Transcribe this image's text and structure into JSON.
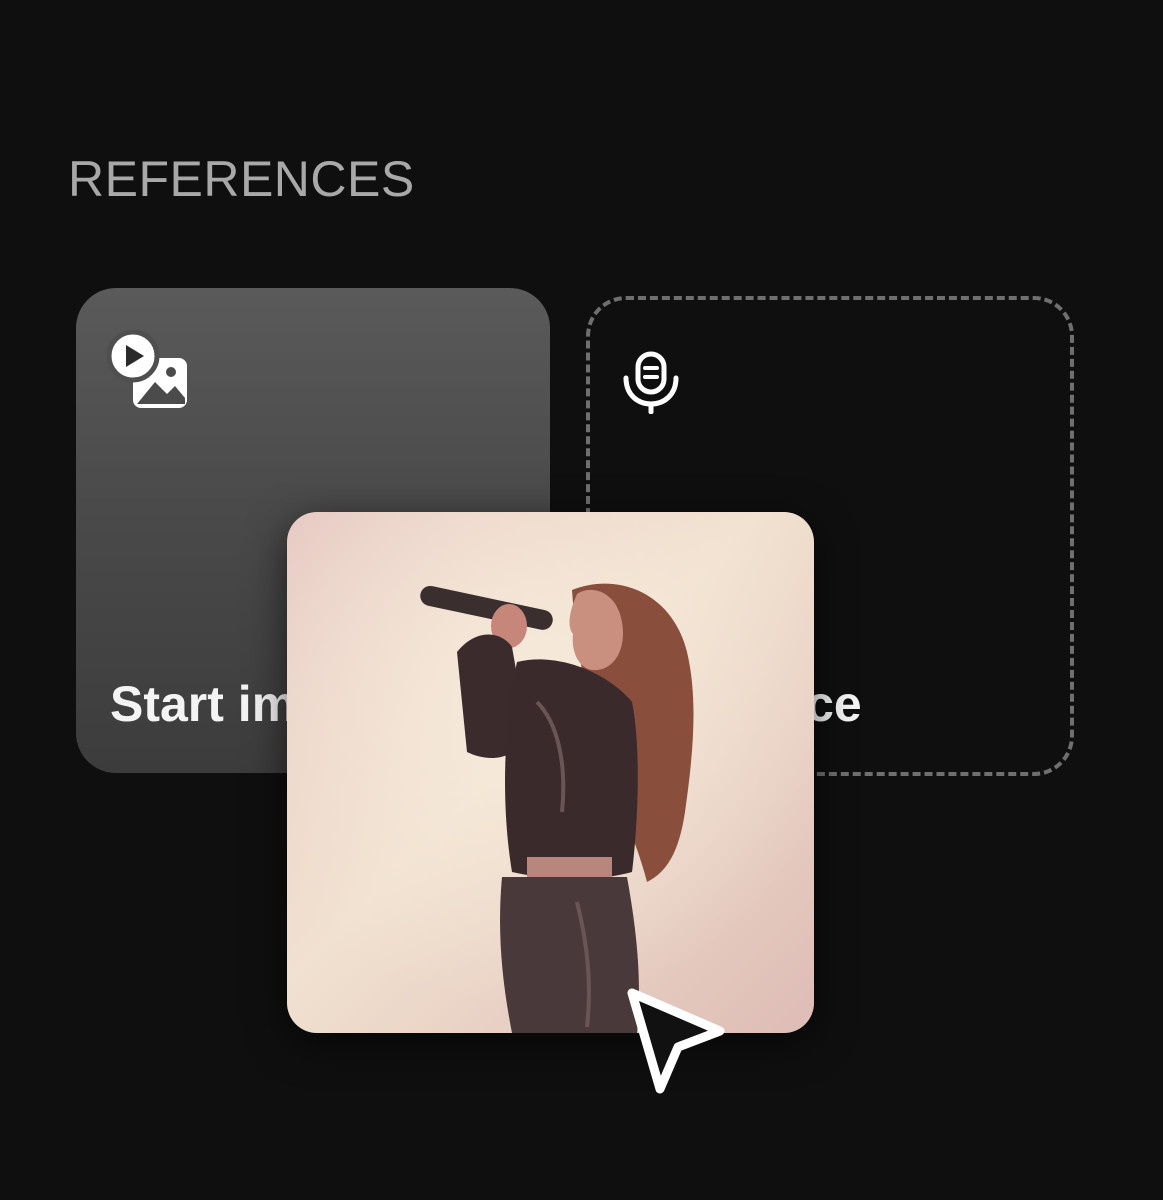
{
  "section": {
    "title": "REFERENCES"
  },
  "cards": {
    "start": {
      "label": "Start image",
      "icon": "image-video-icon"
    },
    "voice": {
      "label": "Voice",
      "icon": "microphone-icon"
    }
  },
  "drag_preview": {
    "description_icon": "photo-thumbnail",
    "cursor": "arrow-cursor-icon"
  },
  "colors": {
    "background": "#0f0f10",
    "title": "#a8a8a8",
    "card_start_top": "#5a5a5a",
    "card_start_bottom": "#3c3c3c",
    "dashed_border": "#6f6f6f"
  }
}
